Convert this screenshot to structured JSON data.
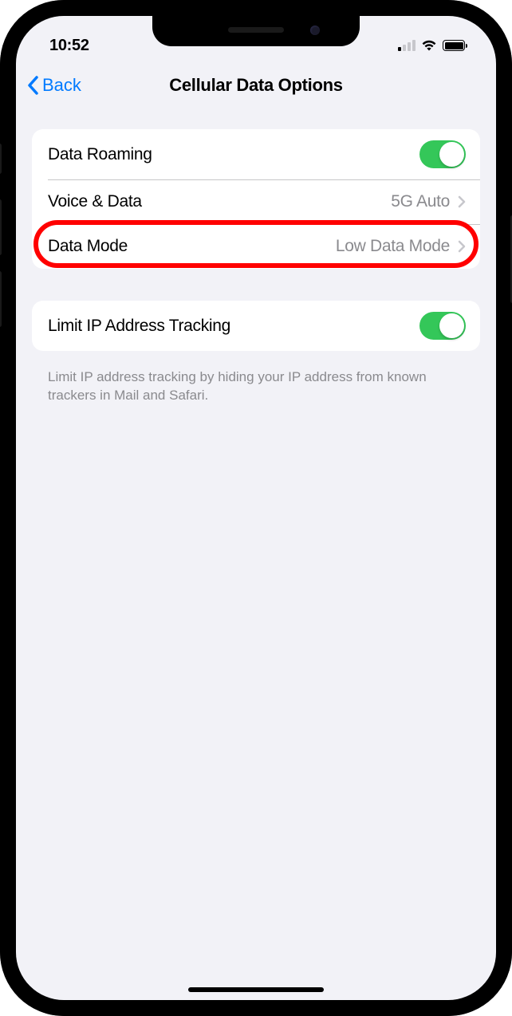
{
  "statusBar": {
    "time": "10:52"
  },
  "nav": {
    "backLabel": "Back",
    "title": "Cellular Data Options"
  },
  "group1": {
    "rows": [
      {
        "label": "Data Roaming",
        "toggle": true
      },
      {
        "label": "Voice & Data",
        "value": "5G Auto"
      },
      {
        "label": "Data Mode",
        "value": "Low Data Mode",
        "highlighted": true
      }
    ]
  },
  "group2": {
    "rows": [
      {
        "label": "Limit IP Address Tracking",
        "toggle": true
      }
    ],
    "footer": "Limit IP address tracking by hiding your IP address from known trackers in Mail and Safari."
  }
}
